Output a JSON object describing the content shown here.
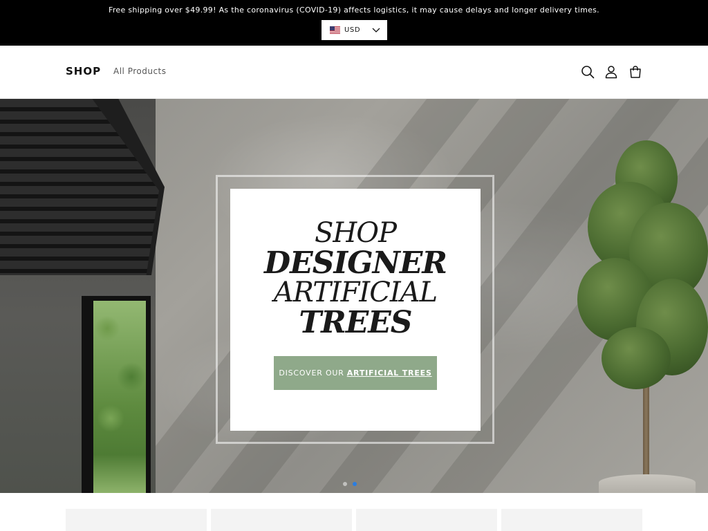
{
  "announcement": {
    "text": "Free shipping over $49.99! As the coronavirus (COVID-19) affects logistics, it may cause delays and longer delivery times."
  },
  "currency": {
    "selected": "USD",
    "flag_icon": "us-flag-icon"
  },
  "header": {
    "logo": "SHOP",
    "nav": [
      {
        "label": "All Products"
      }
    ],
    "icons": [
      "search-icon",
      "account-icon",
      "cart-icon"
    ]
  },
  "hero": {
    "headline_lines": [
      "SHOP",
      "DESIGNER",
      "ARTIFICIAL",
      "TREES"
    ],
    "cta": {
      "prefix": "DISCOVER OUR",
      "emphasis": "ARTIFICIAL TREES"
    },
    "cta_color": "#8fa98a",
    "slides": {
      "count": 2,
      "active": 2
    }
  },
  "colors": {
    "announcement_bg": "#000000",
    "active_dot": "#2a7de1"
  }
}
